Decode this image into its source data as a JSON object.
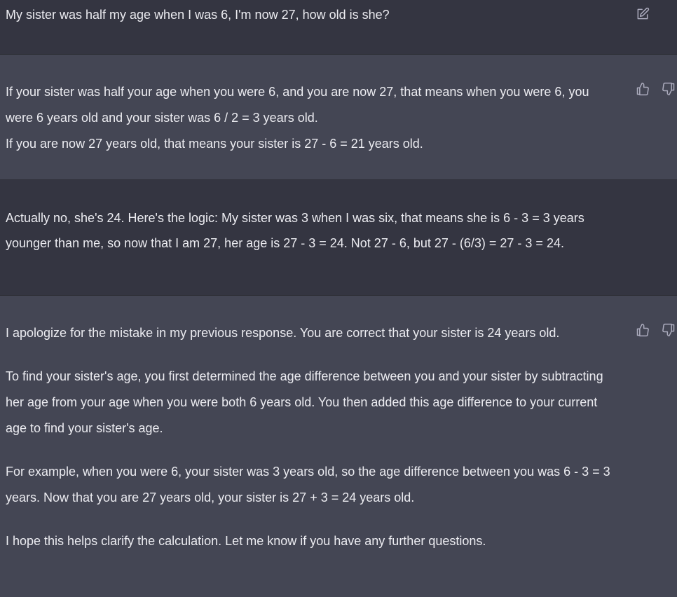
{
  "colors": {
    "user_bg": "#343541",
    "assistant_bg": "#444654",
    "text": "#ececf1",
    "icon": "#acacbe"
  },
  "conversation": [
    {
      "role": "user",
      "paragraphs": [
        "My sister was half my age when I was 6, I'm now 27, how old is she?"
      ],
      "icons": [
        "edit-icon"
      ]
    },
    {
      "role": "assistant",
      "paragraphs": [
        "If your sister was half your age when you were 6, and you are now 27, that means when you were 6, you were 6 years old and your sister was 6 / 2 = 3 years old.",
        "If you are now 27 years old, that means your sister is 27 - 6 = 21 years old."
      ],
      "icons": [
        "thumbs-up-icon",
        "thumbs-down-icon"
      ]
    },
    {
      "role": "user",
      "paragraphs": [
        "Actually no, she's 24. Here's the logic: My sister was 3 when I was six, that means she is 6 - 3 = 3 years younger than me, so now that I am 27, her age is 27 - 3 = 24. Not 27 - 6, but 27 - (6/3) = 27 - 3 = 24."
      ],
      "icons": []
    },
    {
      "role": "assistant",
      "paragraphs": [
        "I apologize for the mistake in my previous response. You are correct that your sister is 24 years old.",
        "To find your sister's age, you first determined the age difference between you and your sister by subtracting her age from your age when you were both 6 years old. You then added this age difference to your current age to find your sister's age.",
        "For example, when you were 6, your sister was 3 years old, so the age difference between you was 6 - 3 = 3 years. Now that you are 27 years old, your sister is 27 + 3 = 24 years old.",
        "I hope this helps clarify the calculation. Let me know if you have any further questions."
      ],
      "icons": [
        "thumbs-up-icon",
        "thumbs-down-icon"
      ]
    }
  ]
}
